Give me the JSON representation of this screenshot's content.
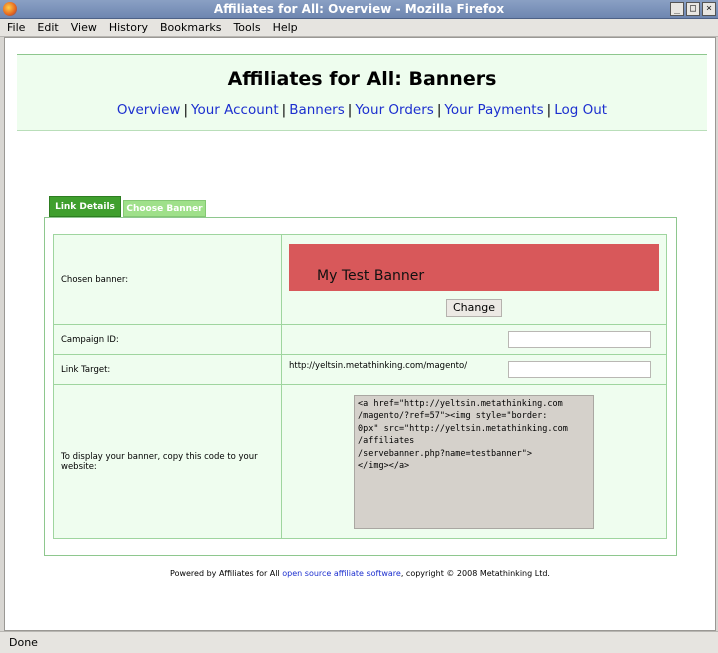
{
  "window": {
    "title": "Affiliates for All: Overview - Mozilla Firefox",
    "controls": [
      "_",
      "□",
      "×"
    ]
  },
  "menu": [
    "File",
    "Edit",
    "View",
    "History",
    "Bookmarks",
    "Tools",
    "Help"
  ],
  "header": {
    "title": "Affiliates for All: Banners",
    "nav": [
      "Overview",
      "Your Account",
      "Banners",
      "Your Orders",
      "Your Payments",
      "Log Out"
    ]
  },
  "tabs": {
    "active": "Link Details",
    "inactive": "Choose Banner"
  },
  "form": {
    "chosen_banner_label": "Chosen banner:",
    "banner_text": "My Test Banner",
    "banner_color": "#d8585a",
    "change_button": "Change",
    "campaign_label": "Campaign ID:",
    "campaign_value": "",
    "link_target_label": "Link Target:",
    "link_target_prefix": "http://yeltsin.metathinking.com/magento/",
    "link_target_value": "",
    "code_label": "To display your banner, copy this code to your website:",
    "code": "<a href=\"http://yeltsin.metathinking.com\n/magento/?ref=57\"><img style=\"border:\n0px\" src=\"http://yeltsin.metathinking.com\n/affiliates\n/servebanner.php?name=testbanner\">\n</img></a>"
  },
  "footer": {
    "prefix": "Powered by Affiliates for All ",
    "link": "open source affiliate software",
    "suffix": ", copyright © 2008 Metathinking Ltd."
  },
  "status": "Done"
}
